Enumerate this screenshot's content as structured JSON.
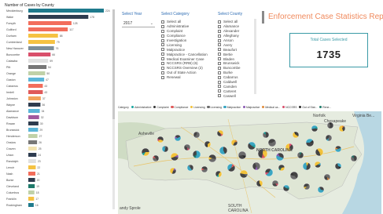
{
  "report": {
    "title": "Enforcement Case Statistics Report"
  },
  "kpi": {
    "label": "Total Cases Selected",
    "value": "1735"
  },
  "year_slicer": {
    "title": "Select Year",
    "selected": "2017"
  },
  "category_slicer": {
    "title": "Select Category",
    "options": [
      "Select all",
      "Administrative",
      "Complaint",
      "Compliance",
      "Investigation",
      "Licensing",
      "Malpractice",
      "Malpractice - Cancellation",
      "Medical Examiner Case",
      "NCCSRS (RRB) (6)",
      "NCCSRS Overview (2)",
      "Out of State Action",
      "Renewal"
    ]
  },
  "county_slicer": {
    "title": "Select County",
    "options": [
      "Select all",
      "Alamance",
      "Alexander",
      "Alleghany",
      "Anson",
      "Avery",
      "Beaufort",
      "Bertie",
      "Bladen",
      "Brunswick",
      "Buncombe",
      "Burke",
      "Cabarrus",
      "Caldwell",
      "Camden",
      "Carteret",
      "Caswell"
    ]
  },
  "map": {
    "legend_title": "Category",
    "legend": [
      {
        "name": "Administrative",
        "color": "#1aa6a0"
      },
      {
        "name": "Complaint",
        "color": "#333333"
      },
      {
        "name": "Compliance",
        "color": "#e05a5a"
      },
      {
        "name": "Licensing",
        "color": "#f2c23a"
      },
      {
        "name": "Licensing",
        "color": "#6b6b6b"
      },
      {
        "name": "Malpractice",
        "color": "#3aa6c2"
      },
      {
        "name": "Malpractice",
        "color": "#8c5ab4"
      },
      {
        "name": "Medical ca...",
        "color": "#e08a3a"
      },
      {
        "name": "NCCSRS",
        "color": "#d94f6b"
      },
      {
        "name": "Out of Stat...",
        "color": "#2a2a2a"
      },
      {
        "name": "Rene...",
        "color": "#1f7a6b"
      }
    ],
    "labels": {
      "norfolk": "Norfolk",
      "chesapeake": "Chesapeake",
      "virginia_beach": "Virginia Be...",
      "asheville": "Asheville",
      "south": "SOUTH",
      "carolina": "CAROLINA",
      "andy_sprole": "andy Sprole",
      "north_carolina": "NORTH CAROLINA"
    }
  },
  "chart_data": {
    "type": "bar",
    "title": "Number of Cases by County",
    "categories": [
      "Mecklenburg",
      "Wake",
      "Forsyth",
      "Guilford",
      "Durham",
      "Cumberland",
      "New Hanover",
      "Buncombe",
      "Catawba",
      "Pitt",
      "Orange",
      "Gaston",
      "Cabarrus",
      "Iredell",
      "Johnston",
      "Wayne",
      "Alamance",
      "Davidson",
      "Rowan",
      "Brunswick",
      "Henderson",
      "Onslow",
      "Craven",
      "Union",
      "Randolph",
      "Lenoir",
      "Nash",
      "Burke",
      "Cleveland",
      "Columbus",
      "Franklin",
      "Rockingham"
    ],
    "values": [
      224,
      178,
      128,
      117,
      88,
      79,
      76,
      66,
      59,
      54,
      50,
      47,
      43,
      43,
      37,
      36,
      34,
      32,
      30,
      29,
      27,
      26,
      25,
      24,
      23,
      22,
      21,
      20,
      19,
      18,
      17,
      16
    ],
    "colors": [
      "#1f7a8c",
      "#2e3c4f",
      "#f26d5b",
      "#f26d5b",
      "#f5c242",
      "#f5c242",
      "#7d8f99",
      "#d94f6b",
      "#e0e0e0",
      "#777777",
      "#c0d1a8",
      "#5bb6d9",
      "#f26d5b",
      "#e05a5a",
      "#f2a35b",
      "#2e3c4f",
      "#5bb6d9",
      "#a05a9e",
      "#2e3c4f",
      "#5bb6d9",
      "#c0d1a8",
      "#777777",
      "#f2e3b0",
      "#2e3c4f",
      "#e0e0e0",
      "#f5c242",
      "#f26d5b",
      "#2e3c4f",
      "#1f7a6b",
      "#c0d1a8",
      "#f5c242",
      "#1f7a8c"
    ]
  }
}
